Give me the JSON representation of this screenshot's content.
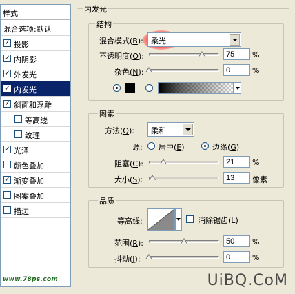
{
  "style_panel": {
    "header": "样式",
    "items": [
      {
        "label": "混合选项:默认",
        "checkbox": false,
        "checked": false,
        "indent": 0,
        "selected": false
      },
      {
        "label": "投影",
        "checkbox": true,
        "checked": true,
        "indent": 0,
        "selected": false
      },
      {
        "label": "内阴影",
        "checkbox": true,
        "checked": true,
        "indent": 0,
        "selected": false
      },
      {
        "label": "外发光",
        "checkbox": true,
        "checked": true,
        "indent": 0,
        "selected": false
      },
      {
        "label": "内发光",
        "checkbox": true,
        "checked": true,
        "indent": 0,
        "selected": true
      },
      {
        "label": "斜面和浮雕",
        "checkbox": true,
        "checked": true,
        "indent": 0,
        "selected": false
      },
      {
        "label": "等高线",
        "checkbox": true,
        "checked": false,
        "indent": 1,
        "selected": false
      },
      {
        "label": "纹理",
        "checkbox": true,
        "checked": false,
        "indent": 1,
        "selected": false
      },
      {
        "label": "光泽",
        "checkbox": true,
        "checked": true,
        "indent": 0,
        "selected": false
      },
      {
        "label": "颜色叠加",
        "checkbox": true,
        "checked": false,
        "indent": 0,
        "selected": false
      },
      {
        "label": "渐变叠加",
        "checkbox": true,
        "checked": true,
        "indent": 0,
        "selected": false
      },
      {
        "label": "图案叠加",
        "checkbox": true,
        "checked": false,
        "indent": 0,
        "selected": false
      },
      {
        "label": "描边",
        "checkbox": true,
        "checked": false,
        "indent": 0,
        "selected": false
      }
    ],
    "check_glyph": "✓"
  },
  "logo_text": "www.78ps.com",
  "watermark_text": "UiBQ.CoM",
  "panel_title": "内发光",
  "structure": {
    "title": "结构",
    "blend_mode_label_pre": "混合模式(",
    "blend_mode_label_key": "B",
    "blend_mode_label_post": "):",
    "blend_mode_value": "柔光",
    "opacity_label_pre": "不透明度(",
    "opacity_label_key": "O",
    "opacity_label_post": "):",
    "opacity_value": "75",
    "opacity_fraction": 0.75,
    "noise_label_pre": "杂色(",
    "noise_label_key": "N",
    "noise_label_post": "):",
    "noise_value": "0",
    "noise_fraction": 0,
    "percent": "%",
    "color_mode": "solid",
    "glow_color": "#000000",
    "highlight_color": "#ff2828"
  },
  "elements": {
    "title": "图素",
    "method_label_pre": "方法(",
    "method_label_key": "Q",
    "method_label_post": "):",
    "method_value": "柔和",
    "source_label": "源:",
    "center_label_pre": "居中(",
    "center_label_key": "E",
    "center_label_post": ")",
    "edge_label_pre": "边缘(",
    "edge_label_key": "G",
    "edge_label_post": ")",
    "source_selected": "edge",
    "choke_label_pre": "阻塞(",
    "choke_label_key": "C",
    "choke_label_post": "):",
    "choke_value": "21",
    "choke_fraction": 0.21,
    "size_label_pre": "大小(",
    "size_label_key": "S",
    "size_label_post": "):",
    "size_value": "13",
    "size_fraction": 0.05,
    "percent": "%",
    "size_unit": "像素"
  },
  "quality": {
    "title": "品质",
    "contour_label": "等高线:",
    "anti_alias_label_pre": "消除锯齿(",
    "anti_alias_label_key": "L",
    "anti_alias_label_post": ")",
    "anti_alias_checked": false,
    "range_label_pre": "范围(",
    "range_label_key": "R",
    "range_label_post": "):",
    "range_value": "50",
    "range_fraction": 0.5,
    "jitter_label_pre": "抖动(",
    "jitter_label_key": "J",
    "jitter_label_post": "):",
    "jitter_value": "0",
    "jitter_fraction": 0,
    "percent": "%"
  }
}
